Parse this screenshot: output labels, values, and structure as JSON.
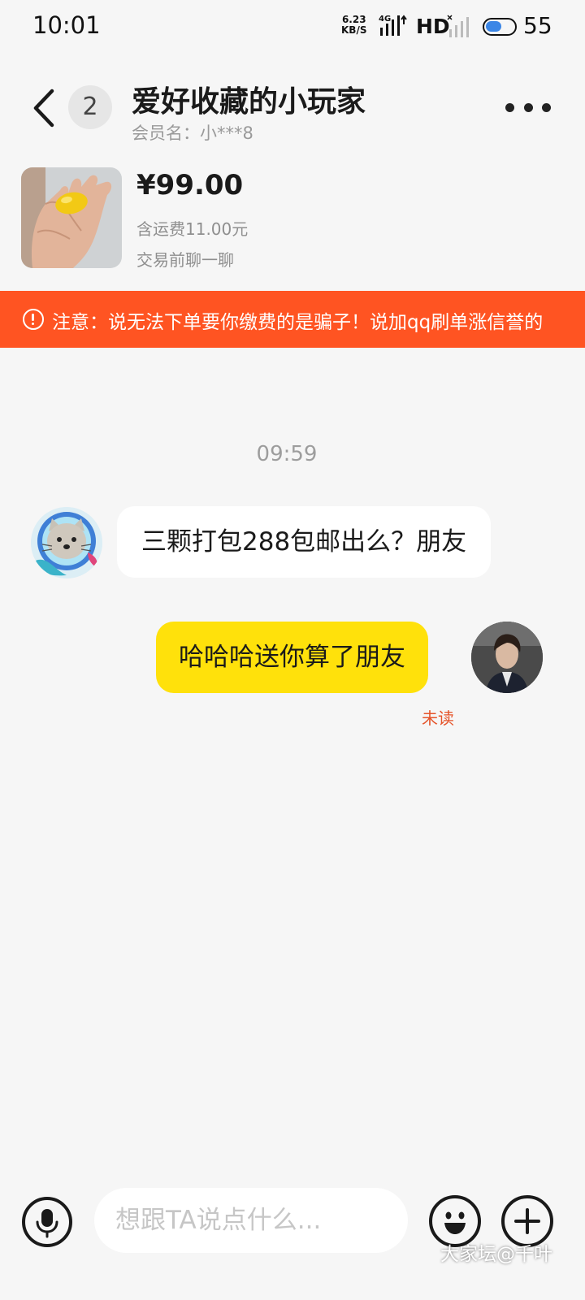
{
  "status_bar": {
    "time": "10:01",
    "net_speed_value": "6.23",
    "net_speed_unit": "KB/S",
    "network_type": "4G",
    "hd_label": "HD",
    "battery_level": "55"
  },
  "header": {
    "unread_count": "2",
    "title": "爱好收藏的小玩家",
    "member_name": "会员名：小***8"
  },
  "product": {
    "price": "¥99.00",
    "shipping": "含运费11.00元",
    "chat_hint": "交易前聊一聊"
  },
  "warning": {
    "text": "注意：说无法下单要你缴费的是骗子！说加qq刷单涨信誉的"
  },
  "messages": {
    "timestamp": "09:59",
    "incoming_text": "三颗打包288包邮出么？朋友",
    "outgoing_text": "哈哈哈送你算了朋友",
    "outgoing_status": "未读"
  },
  "input_bar": {
    "placeholder": "想跟TA说点什么..."
  },
  "watermark": "大家坛@千叶",
  "colors": {
    "warning_bg": "#ff5422",
    "outgoing_bubble": "#ffe10b",
    "unread_text": "#e5542a",
    "page_bg": "#f6f6f6"
  }
}
